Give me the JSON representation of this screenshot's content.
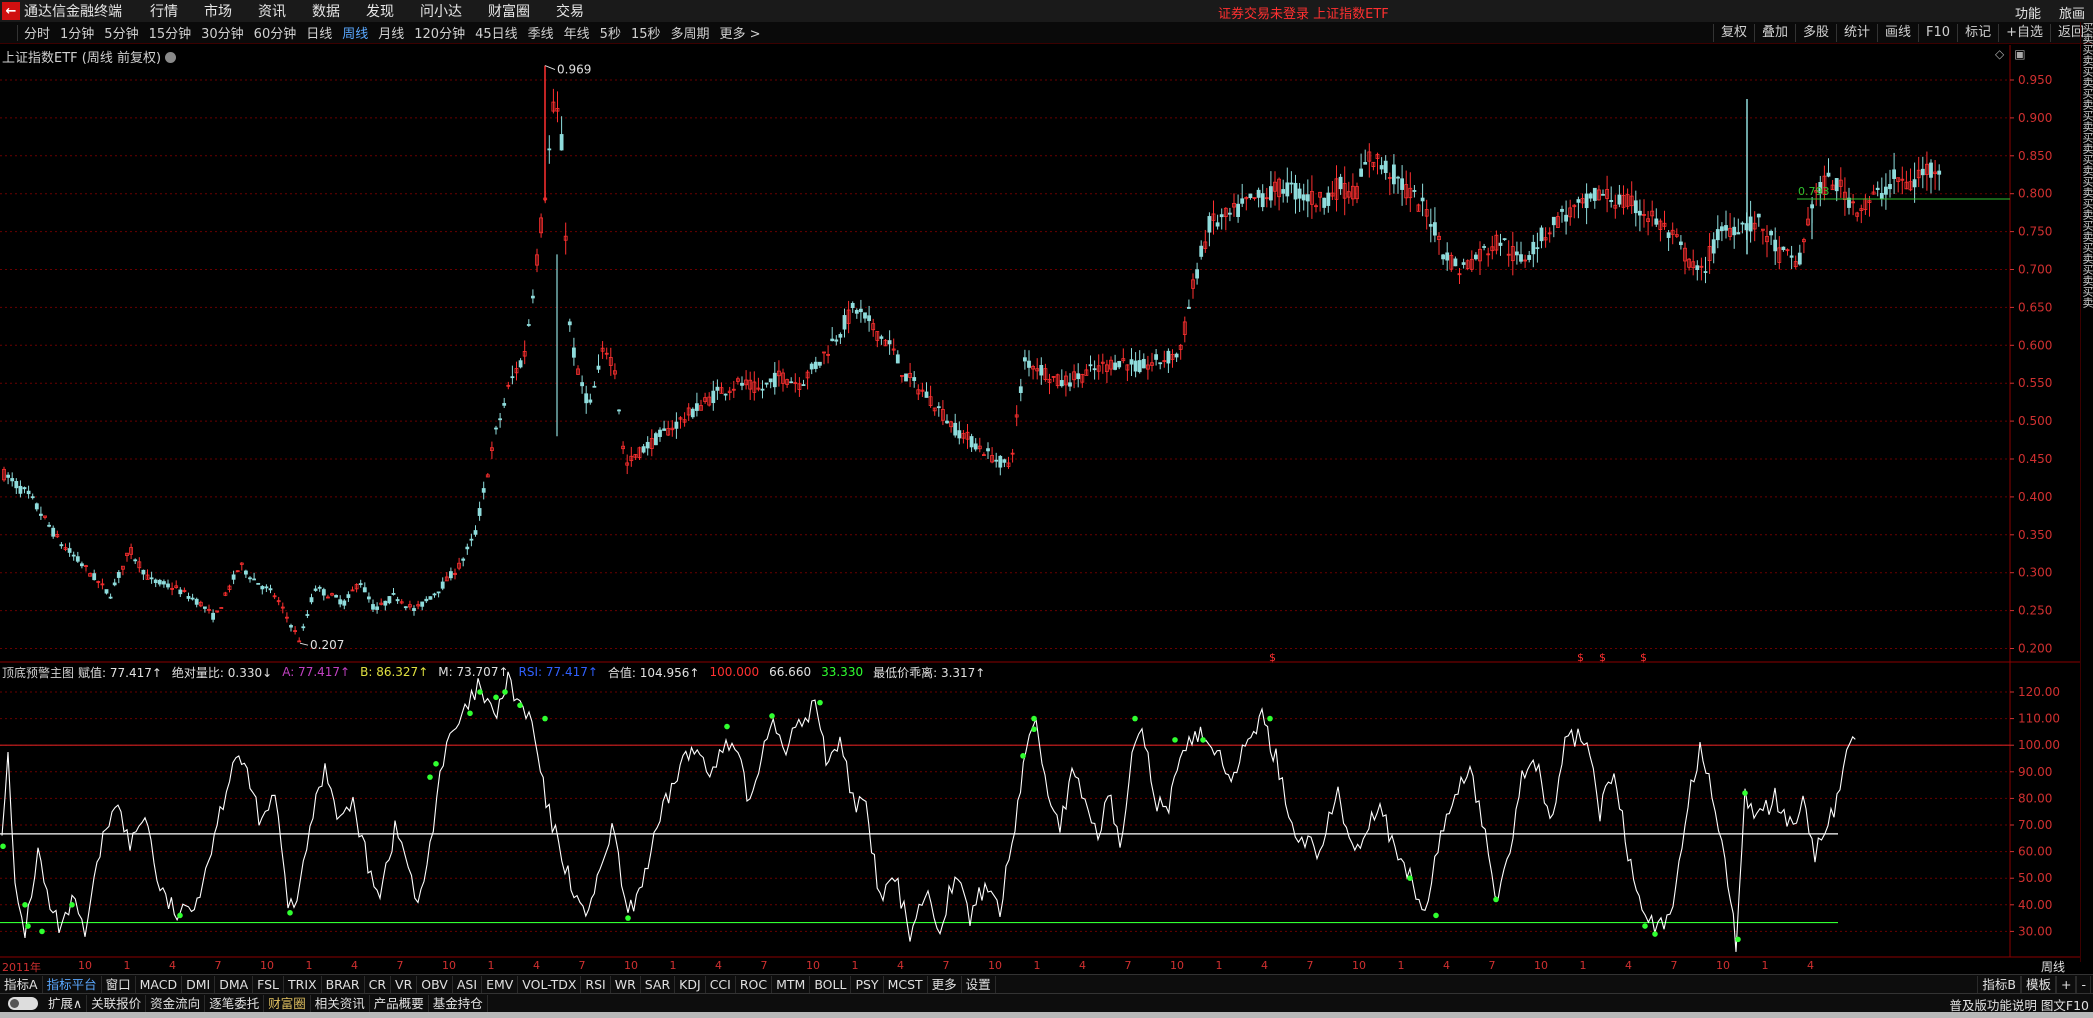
{
  "app": {
    "logo_glyph": "←",
    "title": "通达信金融终端",
    "menu": [
      "行情",
      "市场",
      "资讯",
      "数据",
      "发现",
      "问小达",
      "财富圈",
      "交易"
    ],
    "notice": "证券交易未登录  上证指数ETF",
    "right_menu": [
      "功能",
      "旅画"
    ]
  },
  "periods": {
    "items": [
      "分时",
      "1分钟",
      "5分钟",
      "15分钟",
      "30分钟",
      "60分钟",
      "日线",
      "周线",
      "月线",
      "120分钟",
      "45日线",
      "季线",
      "年线",
      "5秒",
      "15秒",
      "多周期",
      "更多 >"
    ],
    "active": "周线",
    "right_buttons": [
      "复权",
      "叠加",
      "多股",
      "统计",
      "画线",
      "F10",
      "标记",
      "+自选",
      "返回"
    ]
  },
  "chart": {
    "title": "上证指数ETF (周线 前复权)",
    "high_label": "0.969",
    "low_label": "0.207",
    "last_label": "0.793",
    "y_ticks": [
      "0.950",
      "0.900",
      "0.850",
      "0.800",
      "0.750",
      "0.700",
      "0.650",
      "0.600",
      "0.550",
      "0.500",
      "0.450",
      "0.400",
      "0.350",
      "0.300",
      "0.250",
      "0.200"
    ],
    "marker_glyph": "$"
  },
  "indicator": {
    "name": "顶底预警主图",
    "segments": [
      {
        "label": "赋值: 77.417",
        "arrow": "↑",
        "color": "#e0e0e0"
      },
      {
        "label": "绝对量比: 0.330",
        "arrow": "↓",
        "color": "#e0e0e0"
      },
      {
        "label": "A: 77.417",
        "arrow": "↑",
        "color": "#c040c0"
      },
      {
        "label": "B: 86.327",
        "arrow": "↑",
        "color": "#e0e040"
      },
      {
        "label": "M: 73.707",
        "arrow": "↑",
        "color": "#e0e0e0"
      },
      {
        "label": "RSI: 77.417",
        "arrow": "↑",
        "color": "#3060ff"
      },
      {
        "label": "合值: 104.956",
        "arrow": "↑",
        "color": "#e0e0e0"
      },
      {
        "label": "100.000",
        "arrow": "",
        "color": "#ff3030"
      },
      {
        "label": "66.660",
        "arrow": "",
        "color": "#e0e0e0"
      },
      {
        "label": "33.330",
        "arrow": "",
        "color": "#30ff30"
      },
      {
        "label": "最低价乖离: 3.317",
        "arrow": "↑",
        "color": "#e0e0e0"
      }
    ],
    "y_ticks": [
      "120.00",
      "110.00",
      "100.00",
      "90.00",
      "80.00",
      "70.00",
      "60.00",
      "50.00",
      "40.00",
      "30.00"
    ],
    "line_upper": 100,
    "line_mid": 66.66,
    "line_lower": 33.33
  },
  "date_axis": {
    "first_label": "2011年",
    "months": [
      "10",
      "1",
      "4",
      "7"
    ],
    "period_label": "周线"
  },
  "trade_col": "买卖买卖买卖买卖买卖买卖买卖买卖买卖买卖买卖买卖买卖",
  "indicator_tabs": {
    "items": [
      "指标A",
      "指标平台",
      "窗口",
      "MACD",
      "DMI",
      "DMA",
      "FSL",
      "TRIX",
      "BRAR",
      "CR",
      "VR",
      "OBV",
      "ASI",
      "EMV",
      "VOL-TDX",
      "RSI",
      "WR",
      "SAR",
      "KDJ",
      "CCI",
      "ROC",
      "MTM",
      "BOLL",
      "PSY",
      "MCST",
      "更多",
      "设置"
    ],
    "active": "指标平台",
    "right": [
      "指标B",
      "模板",
      "+",
      "-"
    ]
  },
  "bottom_tabs": {
    "items": [
      "扩展∧",
      "关联报价",
      "资金流向",
      "逐笔委托",
      "财富圈",
      "相关资讯",
      "产品概要",
      "基金持仓"
    ],
    "active": "财富圈",
    "right_text": "普及版功能说明 图文F10"
  },
  "colors": {
    "up": "#ff3030",
    "down": "#8fdcdc",
    "grid": "#6a0000",
    "axis": "#d03030",
    "green": "#30ff30",
    "white_line": "#ffffff"
  }
}
